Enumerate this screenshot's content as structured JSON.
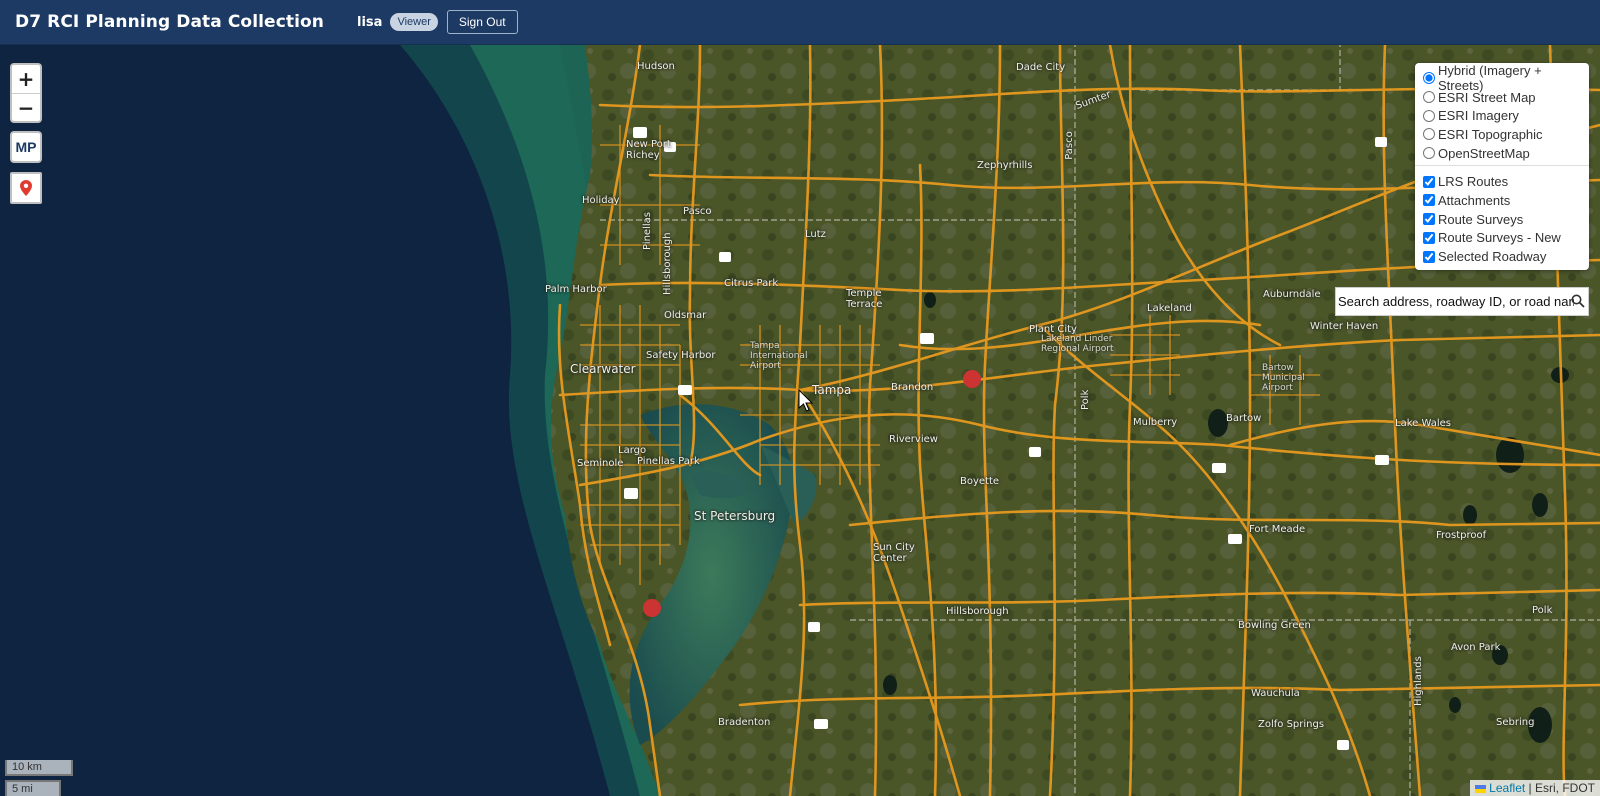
{
  "header": {
    "title": "D7 RCI Planning Data Collection",
    "username": "lisa",
    "role": "Viewer",
    "signout_label": "Sign Out"
  },
  "map_controls": {
    "zoom_in": "+",
    "zoom_out": "−",
    "mp_label": "MP"
  },
  "layers": {
    "basemaps": [
      {
        "label": "Hybrid (Imagery + Streets)",
        "selected": true
      },
      {
        "label": "ESRI Street Map",
        "selected": false
      },
      {
        "label": "ESRI Imagery",
        "selected": false
      },
      {
        "label": "ESRI Topographic",
        "selected": false
      },
      {
        "label": "OpenStreetMap",
        "selected": false
      }
    ],
    "overlays": [
      {
        "label": "LRS Routes",
        "checked": true
      },
      {
        "label": "Attachments",
        "checked": true
      },
      {
        "label": "Route Surveys",
        "checked": true
      },
      {
        "label": "Route Surveys - New",
        "checked": true
      },
      {
        "label": "Selected Roadway",
        "checked": true
      }
    ]
  },
  "search": {
    "placeholder": "Search address, roadway ID, or road name..."
  },
  "scale": {
    "km": "10 km",
    "mi": "5 mi"
  },
  "attribution": {
    "leaflet": "Leaflet",
    "separator": " | ",
    "source": "Esri, FDOT"
  },
  "places": [
    "Hudson",
    "Dade City",
    "Sumter",
    "Pasco",
    "New Port Richey",
    "Zephyrhills",
    "Holiday",
    "Pasco",
    "Lutz",
    "Pinellas",
    "Hillsborough",
    "Palm Harbor",
    "Citrus Park",
    "Temple Terrace",
    "Lakeland",
    "Auburndale",
    "Oldsmar",
    "Tampa International Airport",
    "Plant City",
    "Lakeland Linder Regional Airport",
    "Winter Haven",
    "Safety Harbor",
    "Clearwater",
    "Tampa",
    "Brandon",
    "Bartow",
    "Mulberry",
    "Polk",
    "Lake Wales",
    "Largo",
    "Pinellas Park",
    "Riverview",
    "Seminole",
    "Boyette",
    "St Petersburg",
    "Fort Meade",
    "Frostproof",
    "Sun City Center",
    "Hillsborough",
    "Polk",
    "Bowling Green",
    "Avon Park",
    "Wauchula",
    "Bradenton",
    "Zolfo Springs",
    "Highlands",
    "Sebring",
    "Bartow Municipal Airport"
  ]
}
